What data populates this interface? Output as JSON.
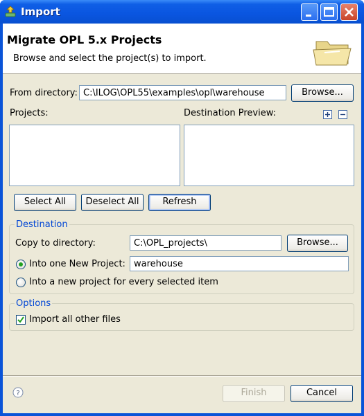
{
  "window": {
    "title": "Import"
  },
  "banner": {
    "title": "Migrate OPL 5.x Projects",
    "description": "Browse and select the project(s) to import."
  },
  "source": {
    "label": "From directory:",
    "value": "C:\\ILOG\\OPL55\\examples\\opl\\warehouse",
    "browse_label": "Browse..."
  },
  "projects": {
    "label": "Projects:",
    "items": []
  },
  "preview": {
    "label": "Destination Preview:",
    "items": []
  },
  "selection_buttons": {
    "select_all": "Select All",
    "deselect_all": "Deselect All",
    "refresh": "Refresh"
  },
  "destination": {
    "legend": "Destination",
    "copy_label": "Copy to directory:",
    "copy_value": "C:\\OPL_projects\\",
    "browse_label": "Browse...",
    "radio_one_label": "Into one New Project:",
    "radio_one_checked": true,
    "project_name": "warehouse",
    "radio_each_label": "Into a new project for every selected item",
    "radio_each_checked": false
  },
  "options": {
    "legend": "Options",
    "import_other_label": "Import all other files",
    "import_other_checked": true
  },
  "footer": {
    "finish_label": "Finish",
    "finish_enabled": false,
    "cancel_label": "Cancel"
  },
  "colors": {
    "titlebar": "#0a55e0",
    "dialog_bg": "#ece9d8",
    "group_legend": "#0046d5",
    "radio_dot": "#21a121"
  }
}
